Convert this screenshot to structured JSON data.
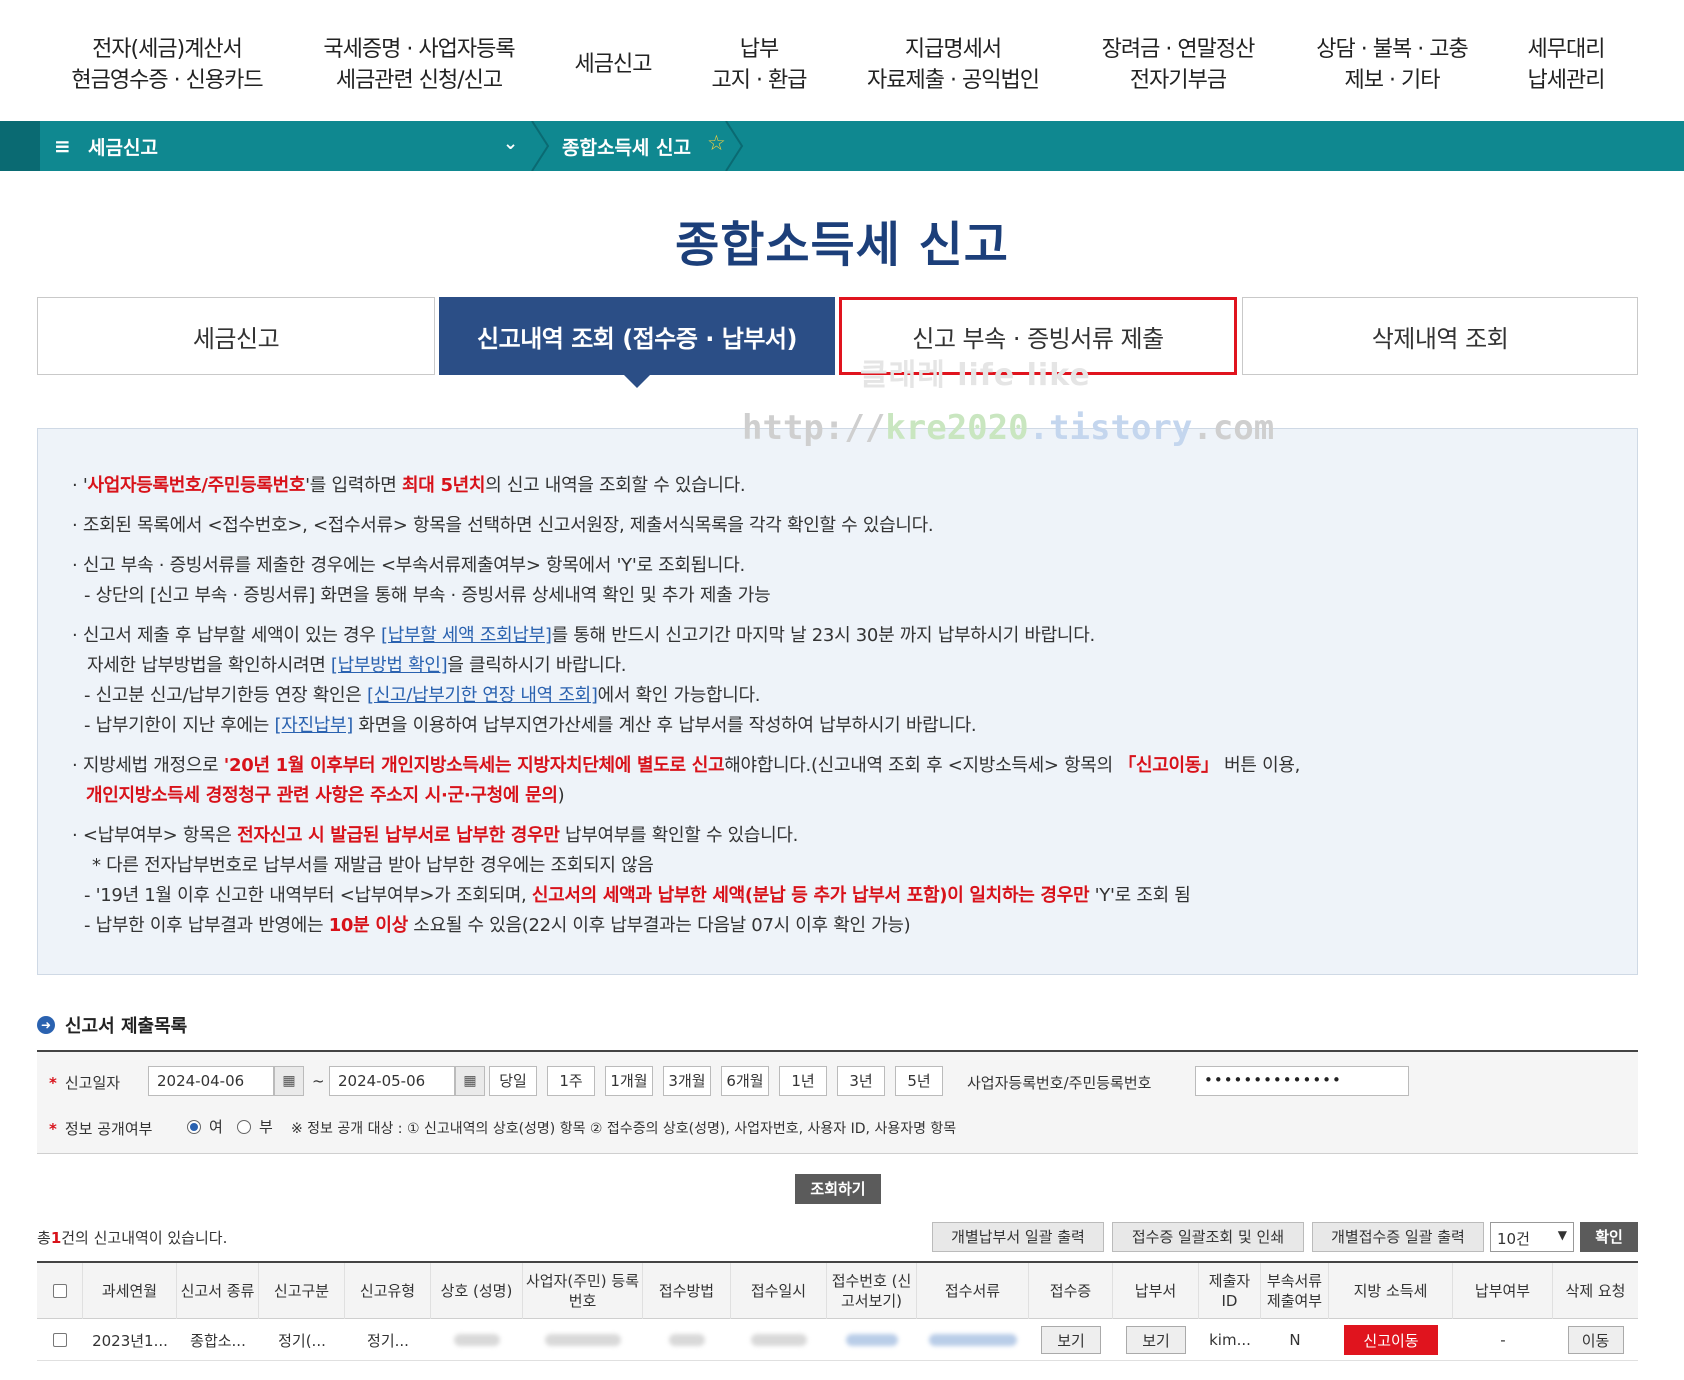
{
  "top_nav": [
    {
      "line1": "전자(세금)계산서",
      "line2": "현금영수증 · 신용카드"
    },
    {
      "line1": "국세증명 · 사업자등록",
      "line2": "세금관련 신청/신고"
    },
    {
      "line1": "세금신고",
      "line2": ""
    },
    {
      "line1": "납부",
      "line2": "고지 · 환급"
    },
    {
      "line1": "지급명세서",
      "line2": "자료제출 · 공익법인"
    },
    {
      "line1": "장려금 · 연말정산",
      "line2": "전자기부금"
    },
    {
      "line1": "상담 · 불복 · 고충",
      "line2": "제보 · 기타"
    },
    {
      "line1": "세무대리",
      "line2": "납세관리"
    }
  ],
  "breadcrumb": {
    "menu_icon": "≡",
    "section": "세금신고",
    "chevron": "⌄",
    "current": "종합소득세 신고",
    "star": "☆"
  },
  "page_title": "종합소득세 신고",
  "tabs": [
    "세금신고",
    "신고내역 조회 (접수증 · 납부서)",
    "신고 부속 · 증빙서류 제출",
    "삭제내역 조회"
  ],
  "watermark": {
    "line1": "클래레 life like",
    "url_a": "http://",
    "url_b": "kre2020",
    "url_c": ".tistory",
    "url_d": ".com"
  },
  "info": {
    "l1_a": "· '",
    "l1_b": "사업자등록번호/주민등록번호",
    "l1_c": "'를 입력하면 ",
    "l1_d": "최대 5년치",
    "l1_e": "의 신고 내역을 조회할 수 있습니다.",
    "l2": "· 조회된 목록에서 <접수번호>, <접수서류> 항목을 선택하면 신고서원장, 제출서식목록을 각각 확인할 수 있습니다.",
    "l3": "· 신고 부속 · 증빙서류를 제출한 경우에는 <부속서류제출여부> 항목에서 'Y'로 조회됩니다.",
    "l4": "- 상단의 [신고 부속 · 증빙서류] 화면을 통해 부속 · 증빙서류 상세내역 확인 및 추가 제출 가능",
    "l5_a": "· 신고서 제출 후 납부할 세액이 있는 경우 ",
    "l5_b": "[납부할 세액 조회납부]",
    "l5_c": "를 통해 반드시 신고기간 마지막 날 23시 30분 까지 납부하시기 바랍니다.",
    "l6_a": "자세한 납부방법을 확인하시려면 ",
    "l6_b": "[납부방법 확인]",
    "l6_c": "을 클릭하시기 바랍니다.",
    "l7_a": "- 신고분 신고/납부기한등 연장 확인은 ",
    "l7_b": "[신고/납부기한 연장 내역 조회]",
    "l7_c": "에서 확인 가능합니다.",
    "l8_a": "- 납부기한이 지난 후에는 ",
    "l8_b": "[자진납부]",
    "l8_c": " 화면을 이용하여 납부지연가산세를 계산 후 납부서를 작성하여 납부하시기 바랍니다.",
    "l9_a": "· 지방세법 개정으로 ",
    "l9_b": "'20년 1월 이후부터 개인지방소득세는 지방자치단체에 별도로 신고",
    "l9_c": "해야합니다.(신고내역 조회 후 <지방소득세> 항목의 ",
    "l9_d": "「신고이동」",
    "l9_e": " 버튼 이용,",
    "l10_a": "개인지방소득세 경정청구 관련 사항은 주소지 시·군·구청에 문의",
    "l10_b": ")",
    "l11_a": "· <납부여부> 항목은 ",
    "l11_b": "전자신고 시 발급된 납부서로 납부한 경우만",
    "l11_c": " 납부여부를 확인할 수 있습니다.",
    "l12": "* 다른 전자납부번호로 납부서를 재발급 받아 납부한 경우에는 조회되지 않음",
    "l13_a": "- '19년 1월 이후 신고한 내역부터 <납부여부>가 조회되며, ",
    "l13_b": "신고서의 세액과 납부한 세액(분납 등 추가 납부서 포함)이 일치하는 경우만",
    "l13_c": " 'Y'로 조회 됨",
    "l14_a": "- 납부한 이후 납부결과 반영에는 ",
    "l14_b": "10분 이상",
    "l14_c": " 소요될 수 있음(22시 이후 납부결과는 다음날 07시 이후 확인 가능)"
  },
  "section_title": "신고서 제출목록",
  "search": {
    "date_label": "신고일자",
    "date_from": "2024-04-06",
    "tilde": "~",
    "date_to": "2024-05-06",
    "periods": [
      "당일",
      "1주",
      "1개월",
      "3개월",
      "6개월",
      "1년",
      "3년",
      "5년"
    ],
    "id_label": "사업자등록번호/주민등록번호",
    "id_value": "••••••••••••••",
    "disclose_label": "정보 공개여부",
    "yes": "여",
    "no": "부",
    "disclose_note": "※ 정보 공개 대상 : ① 신고내역의 상호(성명) 항목 ② 접수증의 상호(성명), 사업자번호, 사용자 ID, 사용자명 항목",
    "search_button": "조회하기"
  },
  "results": {
    "count_prefix": "총",
    "count": "1",
    "count_suffix": "건의 신고내역이 있습니다.",
    "btn_bulk_payment": "개별납부서 일괄 출력",
    "btn_bulk_receipt_view": "접수증 일괄조회 및 인쇄",
    "btn_bulk_receipt_print": "개별접수증 일괄 출력",
    "page_size": "10건",
    "confirm": "확인"
  },
  "table": {
    "headers": [
      "과세연월",
      "신고서 종류",
      "신고구분",
      "신고유형",
      "상호 (성명)",
      "사업자(주민) 등록번호",
      "접수방법",
      "접수일시",
      "접수번호 (신고서보기)",
      "접수서류",
      "접수증",
      "납부서",
      "제출자 ID",
      "부속서류 제출여부",
      "지방 소득세",
      "납부여부",
      "삭제 요청"
    ],
    "row": {
      "period": "2023년1...",
      "form": "종합소...",
      "category": "정기(...",
      "type": "정기...",
      "receipt": "보기",
      "payment": "보기",
      "submitter": "kim...",
      "attach": "N",
      "local_tax": "신고이동",
      "paid": "-",
      "delete": "이동"
    }
  },
  "colors": {
    "teal": "#0f8890",
    "navy": "#2b4e86",
    "red": "#e0141e",
    "title": "#1c3f7a"
  }
}
